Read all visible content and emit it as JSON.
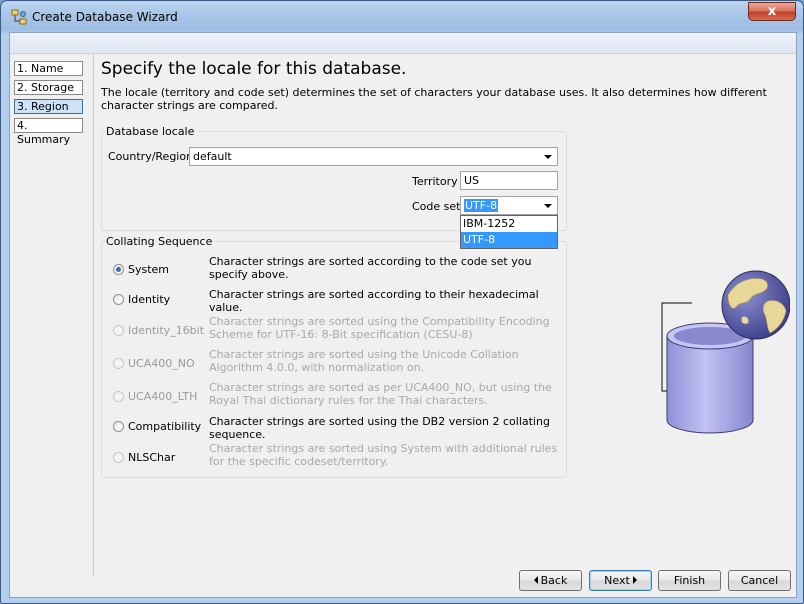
{
  "window": {
    "title": "Create Database Wizard",
    "close_label": "x"
  },
  "nav": {
    "items": [
      {
        "label": "1. Name",
        "active": false
      },
      {
        "label": "2. Storage",
        "active": false
      },
      {
        "label": "3. Region",
        "active": true
      },
      {
        "label": "4. Summary",
        "active": false
      }
    ]
  },
  "page": {
    "heading": "Specify the locale for this database.",
    "description": "The locale (territory and code set) determines the set of characters your database uses. It also determines how different character strings are compared."
  },
  "locale": {
    "group_title": "Database locale",
    "country_label": "Country/Region",
    "country_value": "default",
    "territory_label": "Territory",
    "territory_value": "US",
    "codeset_label": "Code set",
    "codeset_value": "UTF-8",
    "codeset_options": [
      "IBM-1252",
      "UTF-8"
    ]
  },
  "collating": {
    "group_title": "Collating Sequence",
    "options": [
      {
        "label": "System",
        "description": "Character strings are sorted according to the code set you specify above.",
        "enabled": true,
        "checked": true
      },
      {
        "label": "Identity",
        "description": "Character strings are sorted according to their hexadecimal value.",
        "enabled": true,
        "checked": false
      },
      {
        "label": "Identity_16bit",
        "description": "Character strings are sorted using the Compatibility Encoding Scheme for UTF-16: 8-Bit specification (CESU-8)",
        "enabled": false,
        "checked": false
      },
      {
        "label": "UCA400_NO",
        "description": "Character strings are sorted using the Unicode Collation Algorithm 4.0.0, with normalization on.",
        "enabled": false,
        "checked": false
      },
      {
        "label": "UCA400_LTH",
        "description": "Character strings are sorted as per UCA400_NO, but using the Royal Thai dictionary rules for the Thai characters.",
        "enabled": false,
        "checked": false
      },
      {
        "label": "Compatibility",
        "description": "Character strings are sorted using the DB2 version 2 collating sequence.",
        "enabled": true,
        "checked": false
      },
      {
        "label": "NLSChar",
        "description": "Character strings are sorted using System with additional rules for the specific codeset/territory.",
        "enabled": false,
        "checked": false
      }
    ]
  },
  "buttons": {
    "back": "Back",
    "next": "Next",
    "finish": "Finish",
    "cancel": "Cancel"
  },
  "colors": {
    "selection": "#3399ff",
    "cylinder": "#a9a9ee",
    "globe_ocean": "#5e5faa",
    "globe_land": "#e9d79a"
  },
  "illustration": {
    "icons": [
      "globe-icon",
      "database-cylinder-icon"
    ]
  }
}
